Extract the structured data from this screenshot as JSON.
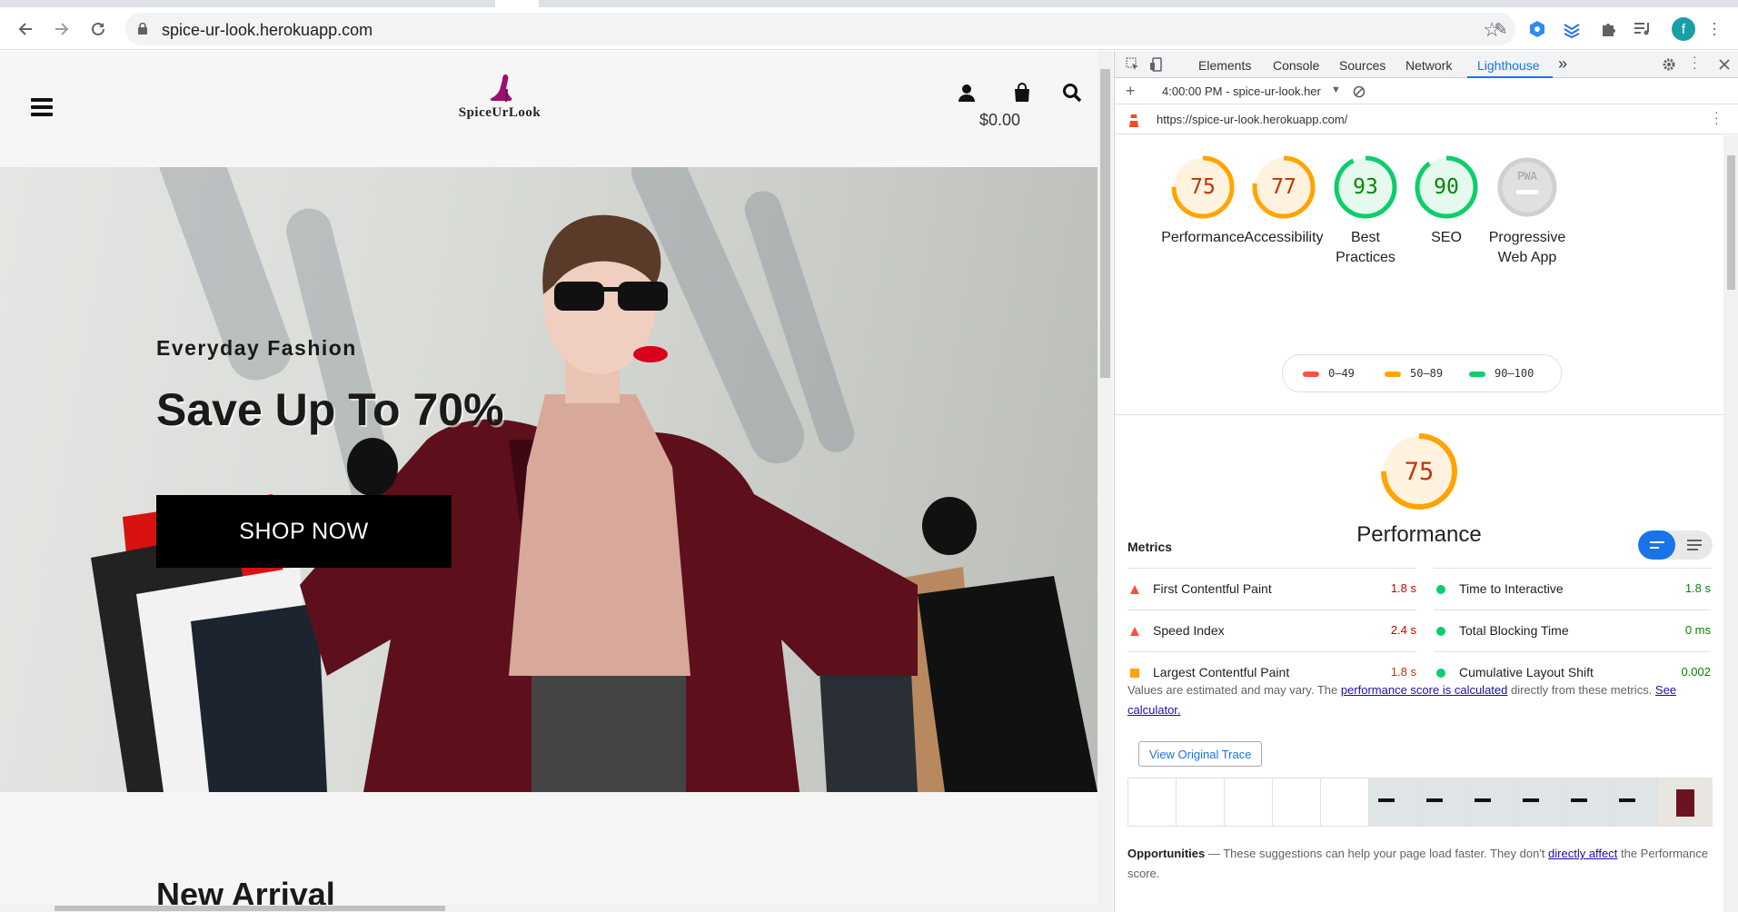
{
  "browser": {
    "url": "spice-ur-look.herokuapp.com",
    "profile_initial": "f"
  },
  "site": {
    "logo_text": "SpiceUrLook",
    "cart_total": "$0.00",
    "hero": {
      "subtitle": "Everyday Fashion",
      "title": "Save Up To 70%",
      "cta": "SHOP NOW"
    },
    "section_title": "New Arrival"
  },
  "devtools": {
    "tabs": [
      "Elements",
      "Console",
      "Sources",
      "Network",
      "Lighthouse"
    ],
    "active_tab": "Lighthouse",
    "more_tabs": "»",
    "report_selector": "4:00:00 PM - spice-ur-look.her",
    "report_url": "https://spice-ur-look.herokuapp.com/"
  },
  "lighthouse": {
    "scores": [
      {
        "label": "Performance",
        "score": "75",
        "status": "average"
      },
      {
        "label": "Accessibility",
        "score": "77",
        "status": "average"
      },
      {
        "label": "Best Practices",
        "score": "93",
        "status": "pass"
      },
      {
        "label": "SEO",
        "score": "90",
        "status": "pass"
      },
      {
        "label": "Progressive Web App",
        "score": "",
        "status": "na",
        "badge": "PWA"
      }
    ],
    "legend": [
      {
        "range": "0–49",
        "color": "#ff4e42"
      },
      {
        "range": "50–89",
        "color": "#ffa400"
      },
      {
        "range": "90–100",
        "color": "#0cce6b"
      }
    ],
    "perf_score": "75",
    "perf_title": "Performance",
    "metrics_title": "Metrics",
    "metrics_left": [
      {
        "name": "First Contentful Paint",
        "value": "1.8 s",
        "status": "fail"
      },
      {
        "name": "Speed Index",
        "value": "2.4 s",
        "status": "fail"
      },
      {
        "name": "Largest Contentful Paint",
        "value": "1.8 s",
        "status": "average"
      }
    ],
    "metrics_right": [
      {
        "name": "Time to Interactive",
        "value": "1.8 s",
        "status": "pass"
      },
      {
        "name": "Total Blocking Time",
        "value": "0 ms",
        "status": "pass"
      },
      {
        "name": "Cumulative Layout Shift",
        "value": "0.002",
        "status": "pass"
      }
    ],
    "note_prefix": "Values are estimated and may vary. The ",
    "note_link": "performance score is calculated",
    "note_middle": " directly from these metrics. ",
    "note_link2": "See calculator.",
    "trace_button": "View Original Trace",
    "opps_title": "Opportunities",
    "opps_text": " — These suggestions can help your page load faster. They don't ",
    "opps_link": "directly affect",
    "opps_tail": " the Performance score."
  },
  "colors": {
    "pass": "#0cce6b",
    "average": "#ffa400",
    "fail": "#ff4e42",
    "pass_text": "#008800",
    "average_text": "#c33300",
    "fail_text": "#cc0000",
    "accent": "#1a73e8"
  }
}
